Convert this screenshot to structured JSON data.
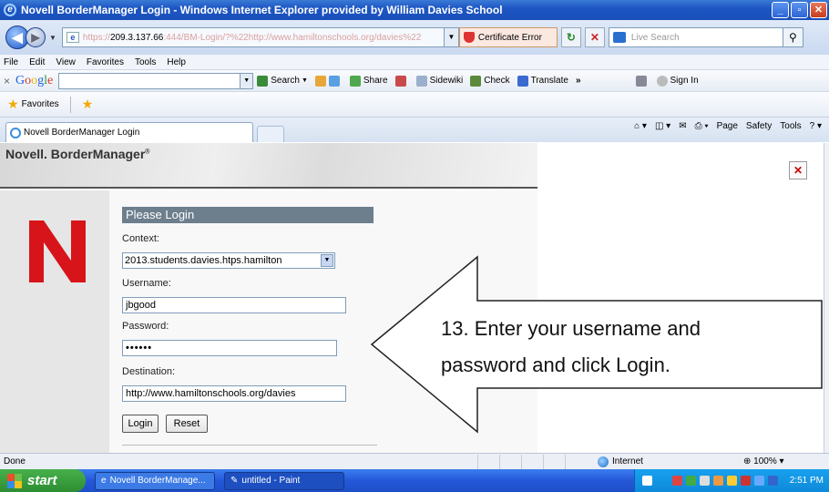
{
  "window": {
    "title": "Novell BorderManager Login - Windows Internet Explorer provided by William Davies School",
    "minimize_label": "_",
    "maximize_label": "▫",
    "close_label": "✕"
  },
  "address": {
    "url_scheme": "https://",
    "url_host": "209.3.137.66",
    "url_rest": ":444/BM-Login/?%22http://www.hamiltonschools.org/davies%22",
    "cert_label": "Certificate Error",
    "refresh_label": "↻",
    "stop_label": "✕",
    "search_placeholder": "Live Search",
    "search_go_label": "⚲"
  },
  "menu": [
    "File",
    "Edit",
    "View",
    "Favorites",
    "Tools",
    "Help"
  ],
  "google_toolbar": {
    "items": [
      "Search",
      "Share",
      "Sidewiki",
      "Check",
      "Translate"
    ],
    "more": "»",
    "sign_in": "Sign In"
  },
  "favorites": {
    "label": "Favorites"
  },
  "tab": {
    "title": "Novell BorderManager Login"
  },
  "command_bar": [
    "Page",
    "Safety",
    "Tools"
  ],
  "page": {
    "brand_title": "Novell. BorderManager",
    "brand_tm": "®",
    "close_label": "✕",
    "login_heading": "Please Login",
    "context_label": "Context:",
    "context_value": "2013.students.davies.htps.hamilton",
    "username_label": "Username:",
    "username_value": "jbgood",
    "password_label": "Password:",
    "password_value": "••••••",
    "destination_label": "Destination:",
    "destination_value": "http://www.hamiltonschools.org/davies",
    "login_button": "Login",
    "reset_button": "Reset"
  },
  "annotation": {
    "line1": "13. Enter your username and",
    "line2": "password and click Login."
  },
  "status": {
    "left": "Done",
    "zone": "Internet",
    "zoom": "100%"
  },
  "taskbar": {
    "start_label": "start",
    "items": [
      "Novell BorderManage...",
      "untitled - Paint"
    ],
    "clock": "2:51 PM"
  },
  "colors": {
    "novell_red": "#d7141a",
    "login_header": "#6d7e8d",
    "xp_blue": "#2458d8",
    "start_green": "#2e8d32"
  }
}
